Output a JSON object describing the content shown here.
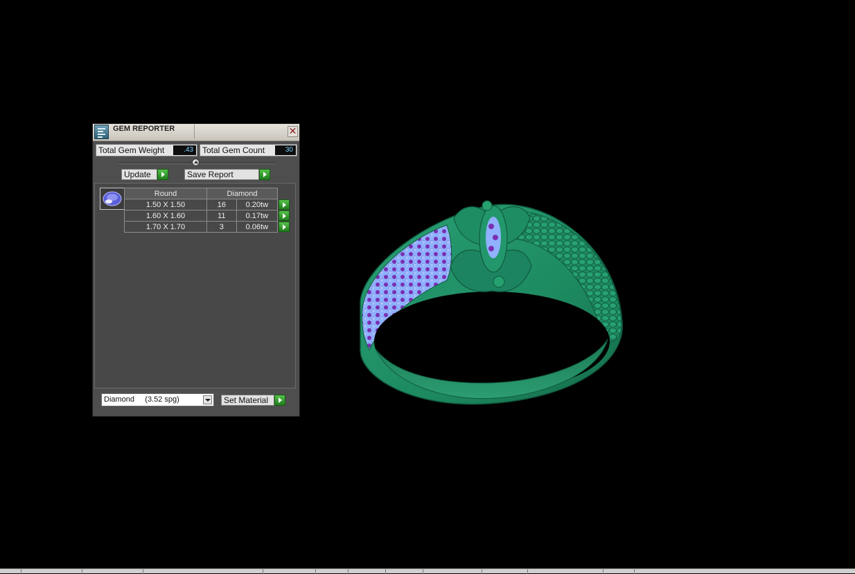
{
  "window": {
    "title": "GEM REPORTER",
    "close_symbol": "✕",
    "icon": "gem-reporter-app-icon"
  },
  "stats": {
    "weight_label": "Total Gem Weight",
    "weight_value": ".43",
    "count_label": "Total Gem Count",
    "count_value": "30"
  },
  "buttons": {
    "update_label": "Update",
    "save_label": "Save Report",
    "set_material_label": "Set Material"
  },
  "table": {
    "headers": [
      "Round",
      "Diamond"
    ],
    "rows": [
      {
        "size": "1.50 X 1.50",
        "count": "16",
        "weight": "0.20tw"
      },
      {
        "size": "1.60 X 1.60",
        "count": "11",
        "weight": "0.17tw"
      },
      {
        "size": "1.70 X 1.70",
        "count": "3",
        "weight": "0.06tw"
      }
    ]
  },
  "material": {
    "selected": "Diamond     (3.52 spg)"
  },
  "colors": {
    "metal": "#1f8a62",
    "stones": "#8fb1ff",
    "accent_stones": "#7a2fb0",
    "go_button": "#2e9b27",
    "value_text": "#7fd0ff"
  }
}
